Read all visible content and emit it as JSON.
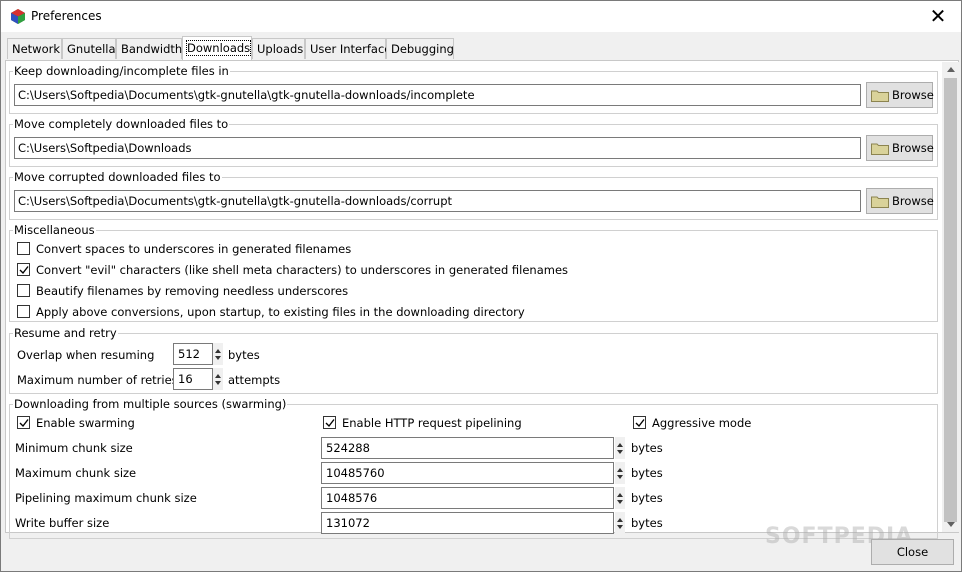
{
  "window": {
    "title": "Preferences"
  },
  "tabs": [
    "Network",
    "Gnutella",
    "Bandwidth",
    "Downloads",
    "Uploads",
    "User Interface",
    "Debugging"
  ],
  "active_tab": "Downloads",
  "paths": {
    "incomplete": {
      "title": "Keep downloading/incomplete files in",
      "value": "C:\\Users\\Softpedia\\Documents\\gtk-gnutella\\gtk-gnutella-downloads/incomplete"
    },
    "complete": {
      "title": "Move completely downloaded files to",
      "value": "C:\\Users\\Softpedia\\Downloads"
    },
    "corrupt": {
      "title": "Move corrupted downloaded files to",
      "value": "C:\\Users\\Softpedia\\Documents\\gtk-gnutella\\gtk-gnutella-downloads/corrupt"
    },
    "browse_label": "Browse"
  },
  "misc": {
    "title": "Miscellaneous",
    "items": [
      {
        "label": "Convert spaces to underscores in generated filenames",
        "checked": false
      },
      {
        "label": "Convert \"evil\" characters (like shell meta characters) to underscores in generated filenames",
        "checked": true
      },
      {
        "label": "Beautify filenames by removing needless underscores",
        "checked": false
      },
      {
        "label": "Apply above conversions, upon startup, to existing files in the downloading directory",
        "checked": false
      }
    ]
  },
  "resume": {
    "title": "Resume and retry",
    "overlap_label": "Overlap when resuming",
    "overlap_value": "512",
    "overlap_unit": "bytes",
    "retries_label": "Maximum number of retries",
    "retries_value": "16",
    "retries_unit": "attempts"
  },
  "swarm": {
    "title": "Downloading from multiple sources (swarming)",
    "enable_swarming": {
      "label": "Enable swarming",
      "checked": true
    },
    "http_pipelining": {
      "label": "Enable HTTP request pipelining",
      "checked": true
    },
    "aggressive": {
      "label": "Aggressive mode",
      "checked": true
    },
    "rows": [
      {
        "label": "Minimum chunk size",
        "value": "524288",
        "unit": "bytes"
      },
      {
        "label": "Maximum chunk size",
        "value": "10485760",
        "unit": "bytes"
      },
      {
        "label": "Pipelining maximum chunk size",
        "value": "1048576",
        "unit": "bytes"
      },
      {
        "label": "Write buffer size",
        "value": "131072",
        "unit": "bytes"
      }
    ]
  },
  "close_label": "Close",
  "watermark": "SOFTPEDIA",
  "icons": {
    "app": "gtk-gnutella-cube-icon",
    "close": "close-icon",
    "folder": "folder-icon"
  }
}
